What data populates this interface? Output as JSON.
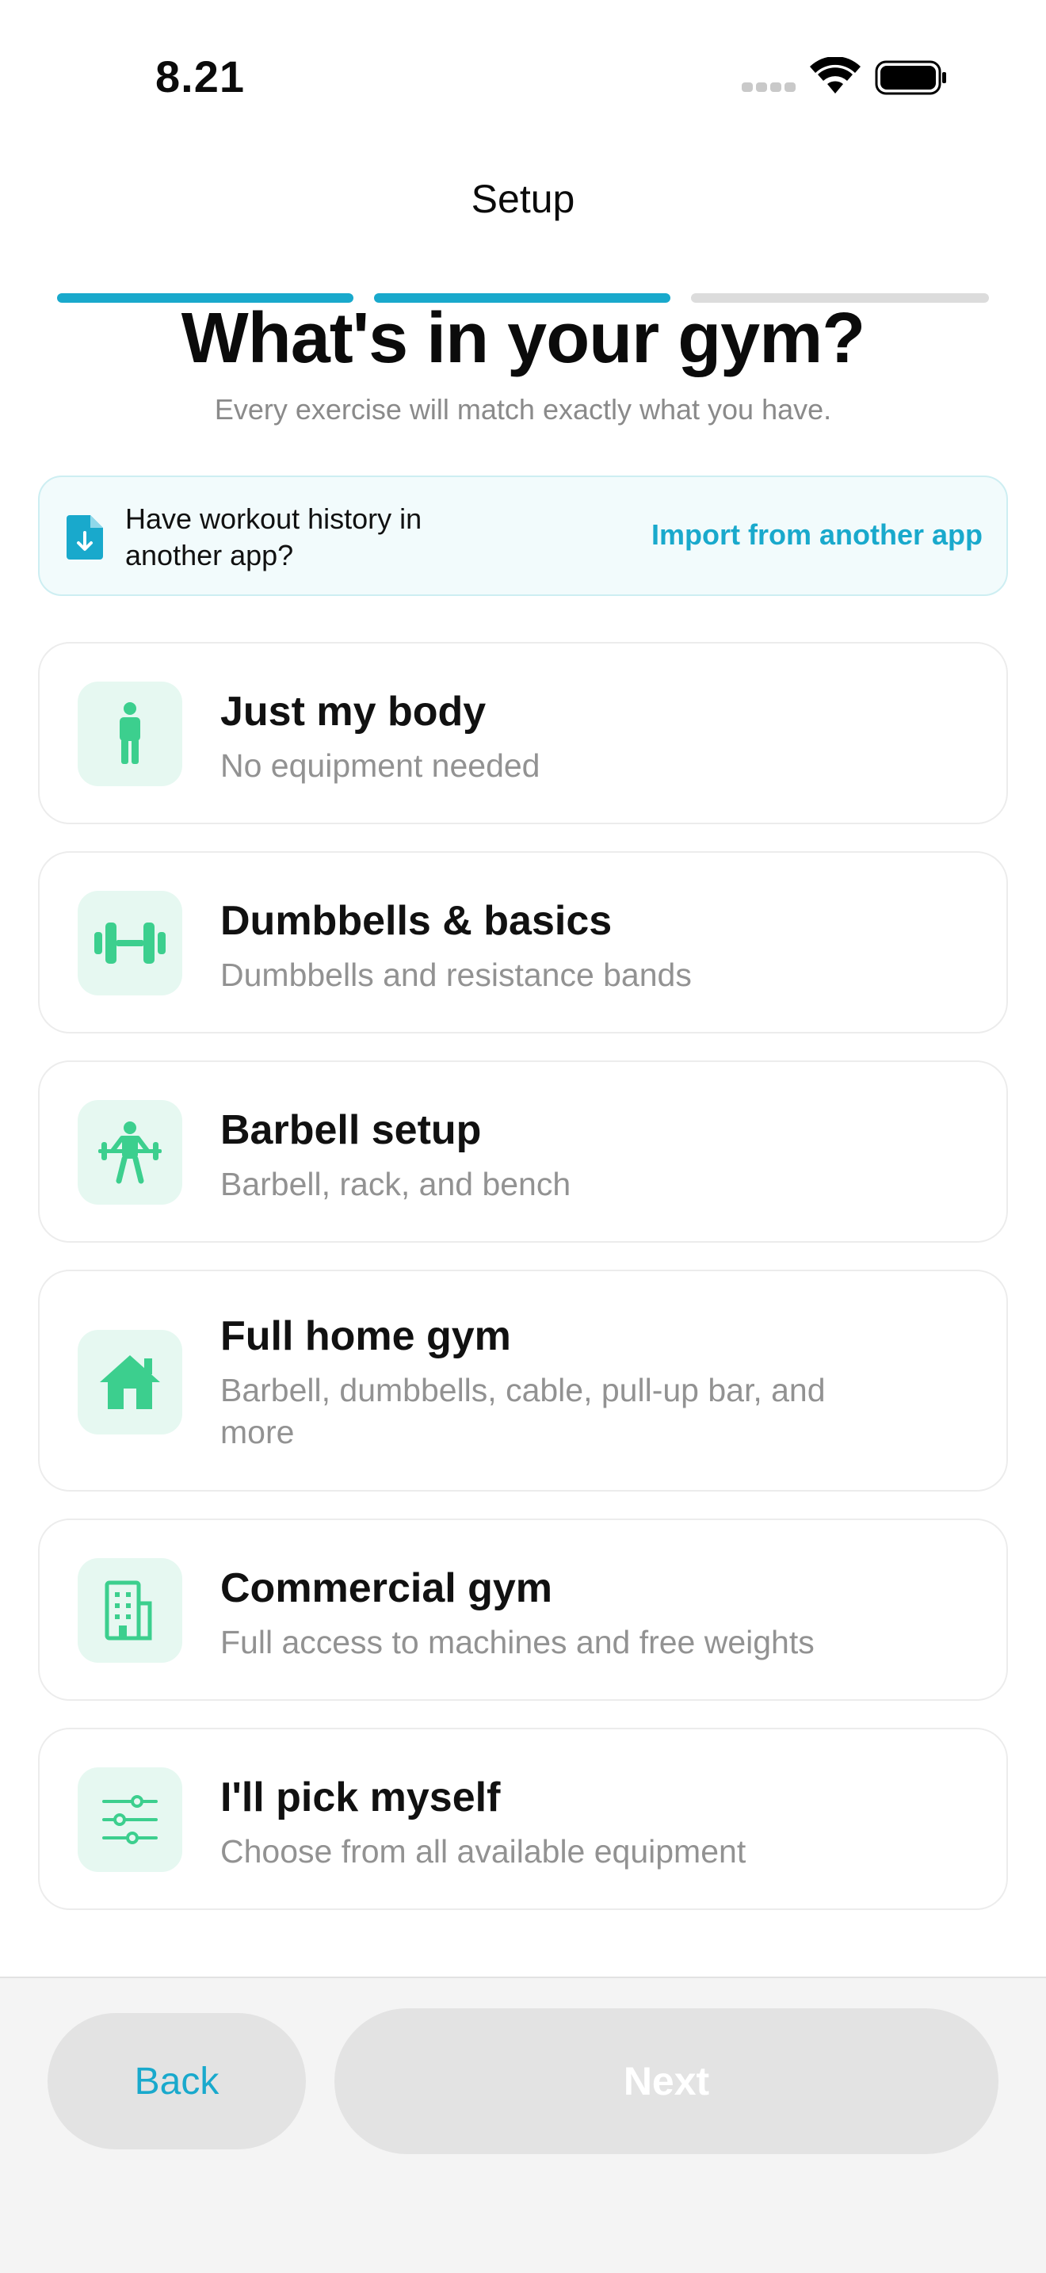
{
  "status_bar": {
    "time": "8.21"
  },
  "nav": {
    "title": "Setup"
  },
  "progress": {
    "total_steps": 3,
    "completed_steps": 2,
    "active_color": "#19a9cc",
    "inactive_color": "#dcdcdc"
  },
  "header": {
    "title": "What's in your gym?",
    "subtitle": "Every exercise will match exactly what you have."
  },
  "import_banner": {
    "text": "Have workout history in another app?",
    "link_label": "Import from another app",
    "icon": "file-download-icon"
  },
  "options": [
    {
      "title": "Just my body",
      "subtitle": "No equipment needed",
      "icon": "person-icon"
    },
    {
      "title": "Dumbbells & basics",
      "subtitle": "Dumbbells and resistance bands",
      "icon": "dumbbell-icon"
    },
    {
      "title": "Barbell setup",
      "subtitle": "Barbell, rack, and bench",
      "icon": "weightlifter-icon"
    },
    {
      "title": "Full home gym",
      "subtitle": "Barbell, dumbbells, cable, pull-up bar, and more",
      "icon": "home-icon"
    },
    {
      "title": "Commercial gym",
      "subtitle": "Full access to machines and free weights",
      "icon": "building-icon"
    },
    {
      "title": "I'll pick myself",
      "subtitle": "Choose from all available equipment",
      "icon": "sliders-icon"
    }
  ],
  "footer": {
    "back_label": "Back",
    "next_label": "Next"
  },
  "colors": {
    "accent": "#19a9cc",
    "icon_green": "#3ccf8e",
    "icon_bg": "#e6f8f1"
  }
}
